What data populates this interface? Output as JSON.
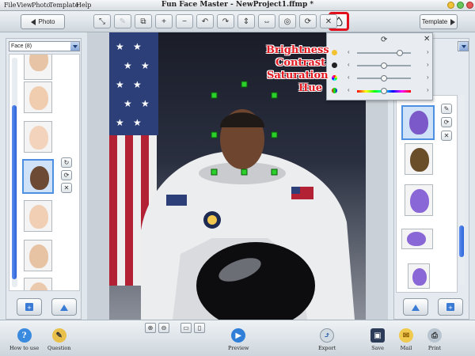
{
  "app": {
    "title": "Fun Face Master - NewProject1.ffmp *",
    "menu": [
      "File",
      "View",
      "Photo",
      "Template",
      "Help"
    ]
  },
  "toolbar": {
    "photo_label": "Photo",
    "template_label": "Template",
    "tools": [
      {
        "icon": "resize-icon",
        "glyph": "⤡"
      },
      {
        "icon": "brush-icon",
        "glyph": "✎",
        "disabled": true
      },
      {
        "icon": "crop-icon",
        "glyph": "⧉"
      },
      {
        "icon": "add-icon",
        "glyph": "+"
      },
      {
        "icon": "remove-icon",
        "glyph": "−"
      },
      {
        "icon": "rotate-left-icon",
        "glyph": "↶"
      },
      {
        "icon": "rotate-right-icon",
        "glyph": "↷"
      },
      {
        "icon": "flip-vertical-icon",
        "glyph": "⇕"
      },
      {
        "icon": "flip-horizontal-icon",
        "glyph": "⇔"
      },
      {
        "icon": "mask-icon",
        "glyph": "◎"
      },
      {
        "icon": "refresh-icon",
        "glyph": "⟳"
      },
      {
        "icon": "close-icon",
        "glyph": "✕"
      }
    ],
    "highlighted_tool": "adjust-icon"
  },
  "left_panel": {
    "dropdown_value": "Face (8)"
  },
  "adjust_panel": {
    "sliders": [
      {
        "name": "Brightness",
        "value": 0.8
      },
      {
        "name": "Contrast",
        "value": 0.5
      },
      {
        "name": "Saturation",
        "value": 0.5
      },
      {
        "name": "Hue",
        "value": 0.5
      }
    ],
    "accent": "#e41a23"
  },
  "bottom_bar": {
    "how_to_use": "How to use",
    "question": "Question",
    "preview": "Preview",
    "export": "Export",
    "save": "Save",
    "mail": "Mail",
    "print": "Print"
  },
  "colors": {
    "highlight": "#e0101c",
    "selection": "#4d8fe0"
  }
}
